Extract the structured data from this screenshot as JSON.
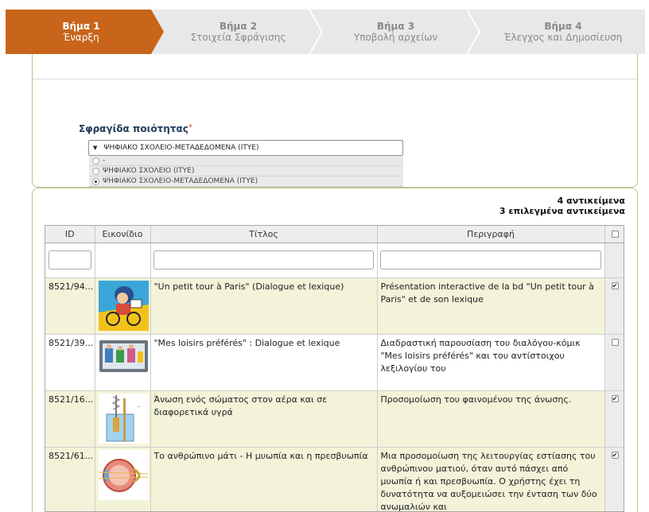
{
  "steps": [
    {
      "title": "Βήμα 1",
      "subtitle": "Έναρξη"
    },
    {
      "title": "Βήμα 2",
      "subtitle": "Στοιχεία Σφράγισης"
    },
    {
      "title": "Βήμα 3",
      "subtitle": "Υποβολή αρχείων"
    },
    {
      "title": "Βήμα 4",
      "subtitle": "Έλεγχος και Δημοσίευση"
    }
  ],
  "colors": {
    "active_step": "#c8651b",
    "inactive_step": "#e8e8e8",
    "panel_border": "#b5c98a",
    "selected_row": "#f3f3d9"
  },
  "seal": {
    "label": "Σφραγίδα ποιότητας",
    "required_mark": "*",
    "selected_value": "ΨΗΦΙΑΚΟ ΣΧΟΛΕΙΟ-ΜΕΤΑΔΕΔΟΜΕΝΑ (ΙΤΥΕ)",
    "options": [
      {
        "label": "-",
        "checked": false
      },
      {
        "label": "ΨΗΦΙΑΚΟ ΣΧΟΛΕΙΟ (ΙΤΥΕ)",
        "checked": false
      },
      {
        "label": "ΨΗΦΙΑΚΟ ΣΧΟΛΕΙΟ-ΜΕΤΑΔΕΔΟΜΕΝΑ (ΙΤΥΕ)",
        "checked": true
      }
    ]
  },
  "counts": {
    "total": "4 αντικείμενα",
    "selected": "3 επιλεγμένα αντικείμενα"
  },
  "grid": {
    "columns": [
      "ID",
      "Εικονίδιο",
      "Τίτλος",
      "Περιγραφή"
    ],
    "rows": [
      {
        "id": "8521/94...",
        "thumb": "comic-icon",
        "title": "\"Un petit tour à Paris\" (Dialogue et lexique)",
        "description": "Présentation interactive de la bd \"Un petit tour à Paris\" et de son lexique",
        "checked": true
      },
      {
        "id": "8521/39...",
        "thumb": "screen-icon",
        "title": "\"Mes loisirs préférés\" : Dialogue et lexique",
        "description": "Διαδραστική παρουσίαση του διαλόγου-κόμικ \"Mes loisirs préférés\" και του αντίστοιχου λεξιλογίου του",
        "checked": false
      },
      {
        "id": "8521/16...",
        "thumb": "buoyancy-icon",
        "title": "Άνωση ενός σώματος στον αέρα και σε διαφορετικά υγρά",
        "description": "Προσομοίωση του φαινομένου της άνωσης.",
        "checked": true
      },
      {
        "id": "8521/61...",
        "thumb": "eye-icon",
        "title": "Το ανθρώπινο μάτι - Η μυωπία και η πρεσβυωπία",
        "description": "Μια προσομοίωση της λειτουργίας εστίασης του ανθρώπινου ματιού, όταν αυτό πάσχει από μυωπία ή και πρεσβυωπία. Ο χρήστης έχει τη δυνατότητα να αυξομειώσει την ένταση των δύο ανωμαλιών και",
        "checked": true
      }
    ]
  }
}
